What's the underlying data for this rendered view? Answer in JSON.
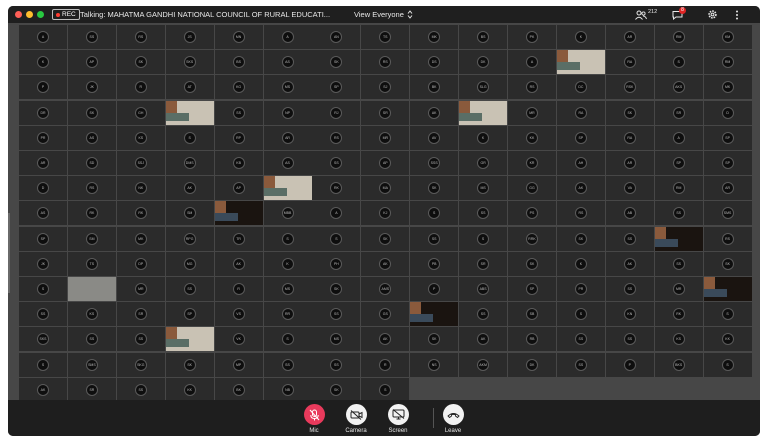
{
  "window": {
    "traffic_lights": [
      "#fe5f57",
      "#febc2e",
      "#28c840"
    ],
    "rec_badge": "REC",
    "talking": "Talking: MAHATMA GANDHI NATIONAL COUNCIL OF RURAL EDUCATI...",
    "view_select": "View Everyone",
    "participants_count": "212",
    "chat_unread": "8"
  },
  "grid": {
    "columns": 15,
    "rows": 15,
    "last_row_tiles": 8,
    "avatar_labels": [
      "A",
      "SS",
      "RS",
      "JS",
      "MN",
      "A",
      "AN",
      "TS",
      "MK",
      "BS",
      "PK",
      "K",
      "AR",
      "RM",
      "KM",
      "K",
      "AP",
      "SK",
      "SKS",
      "BS",
      "AS",
      "SK",
      "RS",
      "DS",
      "DK",
      "A",
      "RA",
      "S",
      "RM",
      "P",
      "JK",
      "R",
      "AT",
      "KG",
      "MS",
      "SP",
      "SJ",
      "BK",
      "SLG",
      "RS",
      "DC",
      "RSK",
      "AKS",
      "MK",
      "DR",
      "SK",
      "GH",
      "SS",
      "NP",
      "RJ",
      "SR",
      "AK",
      "MR",
      "RA",
      "SK",
      "SR",
      "D",
      "PR",
      "AS",
      "KS",
      "S",
      "RP",
      "AR",
      "RS",
      "MR",
      "AV",
      "K",
      "KK",
      "SP",
      "RA",
      "A",
      "SP",
      "AR",
      "SD",
      "SSJ",
      "DMS",
      "KB",
      "AS",
      "SS",
      "AP",
      "SSS",
      "GR",
      "KR",
      "AH",
      "AR",
      "SP",
      "SP",
      "D",
      "RS",
      "NK",
      "AK",
      "AP",
      "RK",
      "MA",
      "SK",
      "MS",
      "GG",
      "AK",
      "VA",
      "RM",
      "AR",
      "AS",
      "RK",
      "RK",
      "SM",
      "MBB",
      "A",
      "KJ",
      "S",
      "SS",
      "PS",
      "RS",
      "AB",
      "SS",
      "SMS",
      "SP",
      "SM",
      "MK",
      "RPG",
      "TR",
      "S",
      "S",
      "SK",
      "SS",
      "S",
      "RRK",
      "SK",
      "SS",
      "RS",
      "JK",
      "TS",
      "DP",
      "MG",
      "AK",
      "K",
      "PH",
      "AK",
      "PB",
      "SR",
      "SK",
      "K",
      "AK",
      "SS",
      "SK",
      "S",
      "MR",
      "SS",
      "R",
      "MS",
      "SK",
      "AMS",
      "P",
      "ABS",
      "SP",
      "PR",
      "SS",
      "MR",
      "SS",
      "KS",
      "SR",
      "SP",
      "VS",
      "RR",
      "SS",
      "GS",
      "SS",
      "SB",
      "S",
      "KN",
      "RK",
      "S",
      "SKS",
      "SS",
      "SS",
      "VK",
      "S",
      "MS",
      "AK",
      "SK",
      "AK",
      "RB",
      "SS",
      "SS",
      "KS",
      "KK",
      "S",
      "SMS",
      "SKG",
      "SK",
      "MP",
      "SS",
      "SS",
      "R",
      "NS",
      "AKM",
      "DK",
      "SS",
      "P",
      "BKS",
      "S",
      "AK",
      "SR",
      "SS",
      "KK",
      "BK",
      "NB",
      "SK",
      "S",
      "RS",
      "AR",
      "RB",
      "S",
      "AS",
      "SSK",
      "RS",
      "VB",
      "SS",
      "VK"
    ]
  },
  "controls": {
    "mic": "Mic",
    "camera": "Camera",
    "screen": "Screen",
    "leave": "Leave"
  }
}
